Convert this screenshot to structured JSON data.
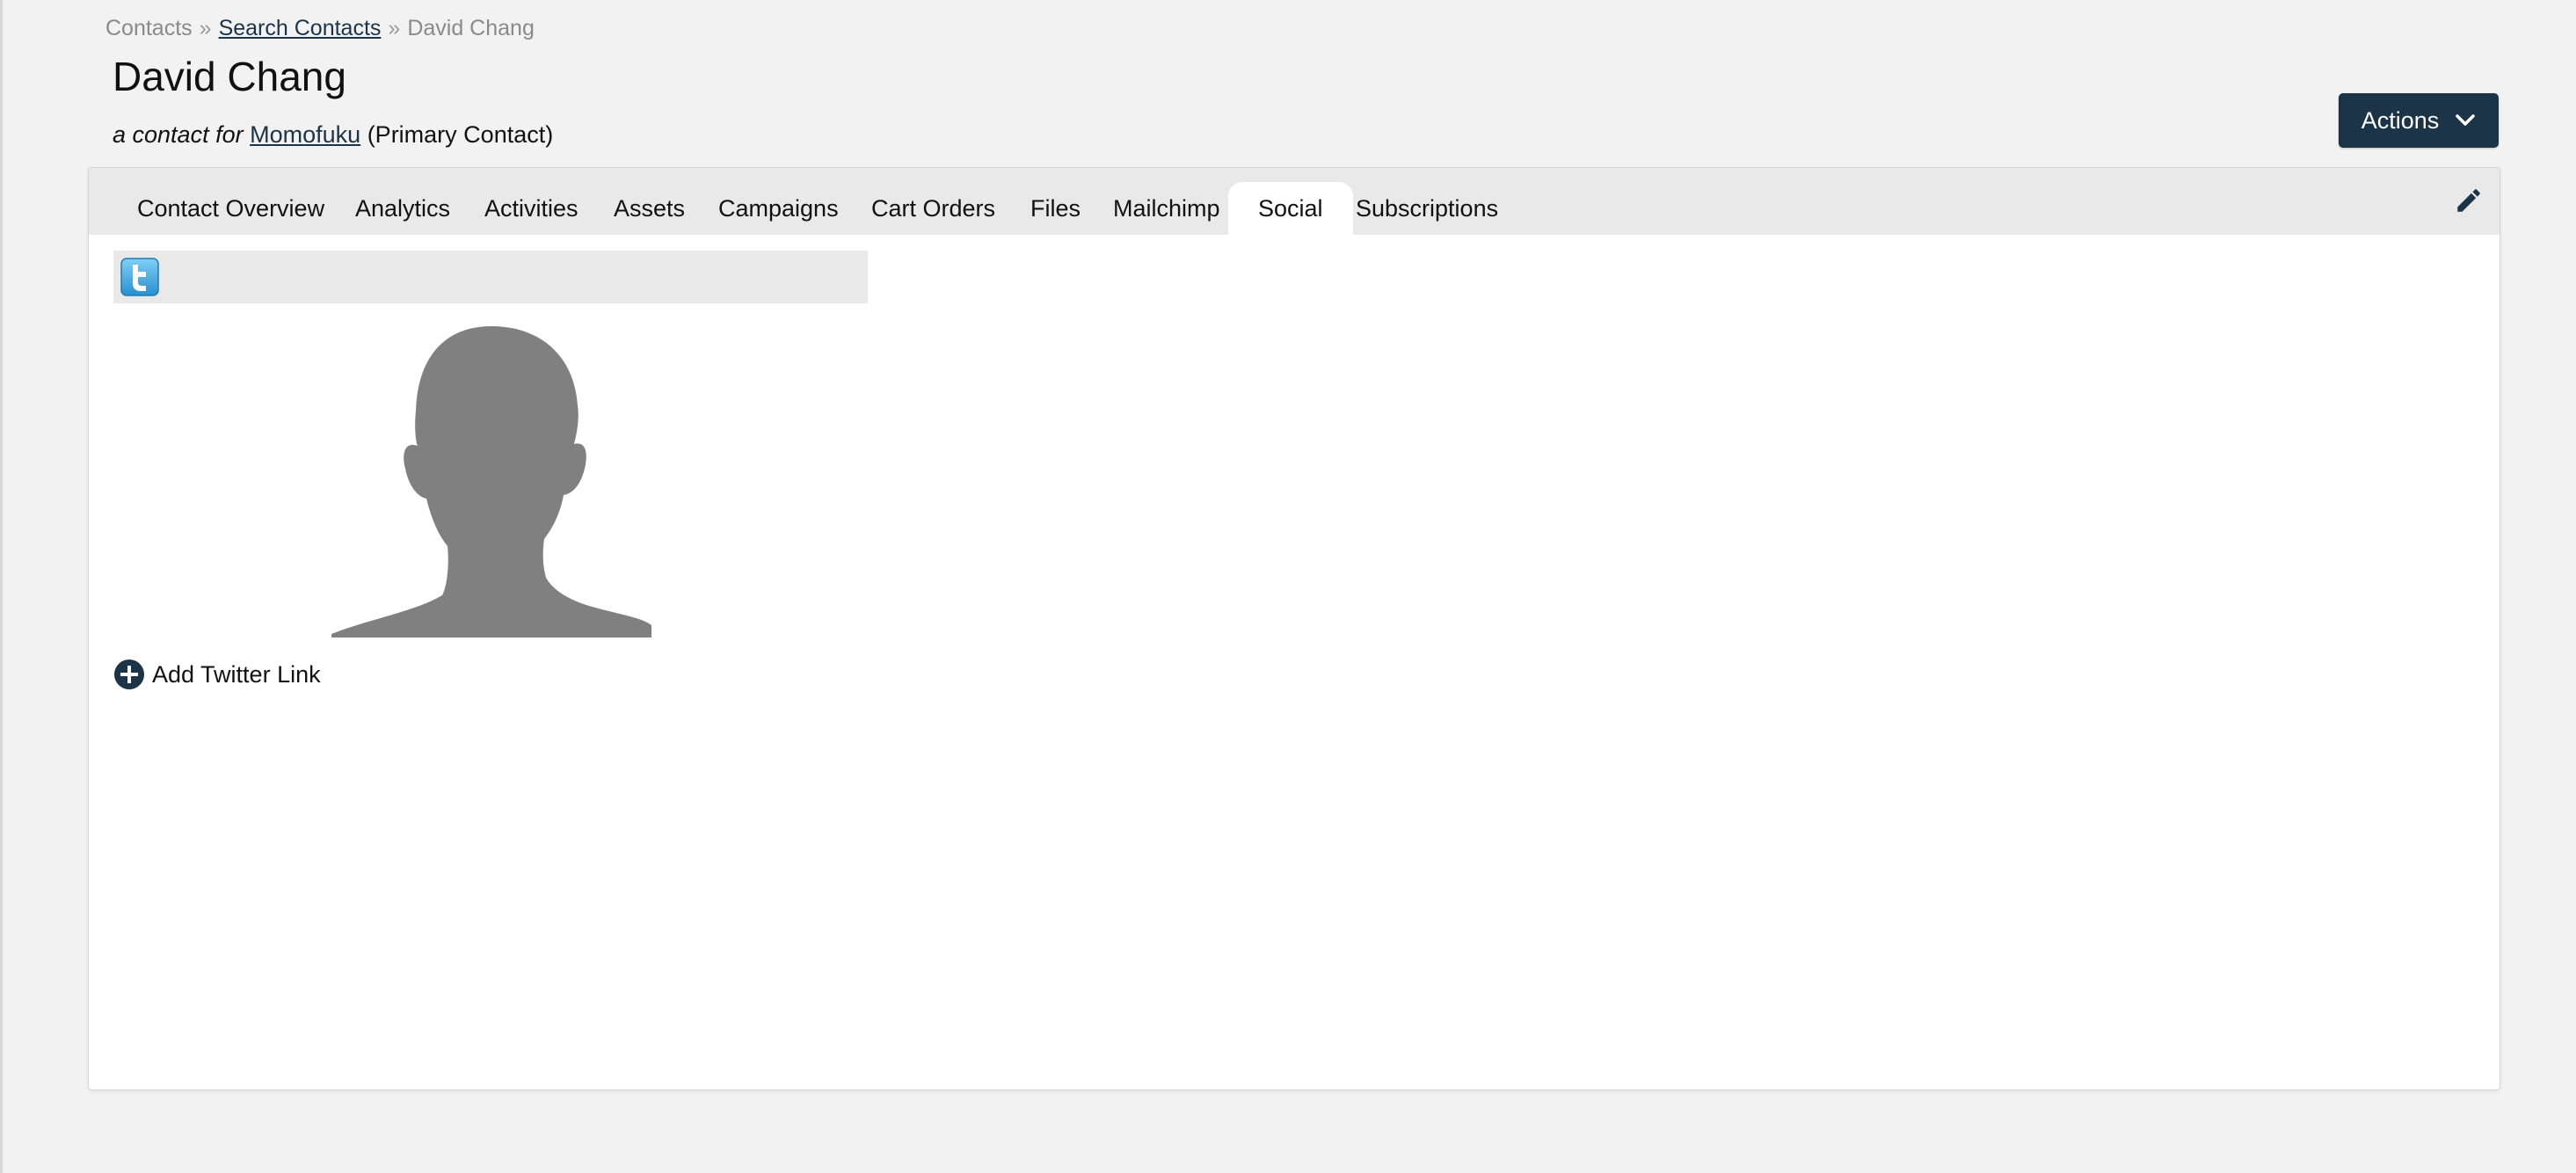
{
  "breadcrumb": {
    "root": "Contacts",
    "separator": "»",
    "search": "Search Contacts",
    "current": "David Chang"
  },
  "contact": {
    "name": "David Chang",
    "subtitle_prefix": "a contact for",
    "company": "Momofuku",
    "role": "(Primary Contact)"
  },
  "actions": {
    "label": "Actions",
    "icon": "chevron-down-icon"
  },
  "tabs": [
    {
      "label": "Contact Overview",
      "active": false
    },
    {
      "label": "Analytics",
      "active": false
    },
    {
      "label": "Activities",
      "active": false
    },
    {
      "label": "Assets",
      "active": false
    },
    {
      "label": "Campaigns",
      "active": false
    },
    {
      "label": "Cart Orders",
      "active": false
    },
    {
      "label": "Files",
      "active": false
    },
    {
      "label": "Mailchimp",
      "active": false
    },
    {
      "label": "Social",
      "active": true
    },
    {
      "label": "Subscriptions",
      "active": false
    }
  ],
  "social": {
    "network_icon": "twitter-icon",
    "avatar_icon": "person-silhouette-icon",
    "add_link_label": "Add Twitter Link"
  },
  "colors": {
    "brand": "#1c3447",
    "tab_bar": "#e9e9e9",
    "avatar_gray": "#808080",
    "twitter_blue": "#3fa9e0"
  }
}
